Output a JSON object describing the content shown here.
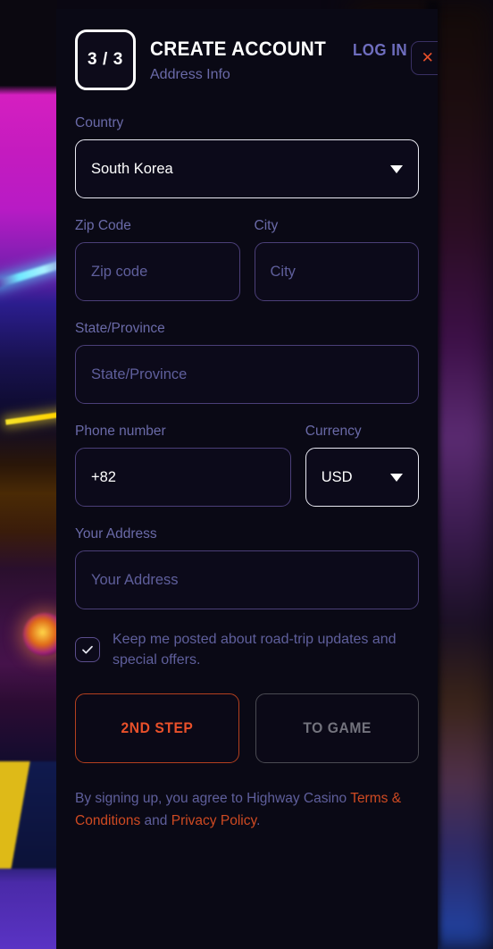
{
  "header": {
    "step_badge": "3 / 3",
    "title": "CREATE ACCOUNT",
    "login_label": "LOG IN",
    "subtitle": "Address Info",
    "close_icon": "close-icon",
    "close_glyph": "✕"
  },
  "form": {
    "country": {
      "label": "Country",
      "value": "South Korea",
      "caret_icon": "chevron-down-icon"
    },
    "zip": {
      "label": "Zip Code",
      "placeholder": "Zip code",
      "value": ""
    },
    "city": {
      "label": "City",
      "placeholder": "City",
      "value": ""
    },
    "state": {
      "label": "State/Province",
      "placeholder": "State/Province",
      "value": ""
    },
    "phone": {
      "label": "Phone number",
      "value": "+82"
    },
    "currency": {
      "label": "Currency",
      "value": "USD",
      "caret_icon": "chevron-down-icon"
    },
    "address": {
      "label": "Your Address",
      "placeholder": "Your Address",
      "value": ""
    }
  },
  "consent": {
    "checked": true,
    "check_icon": "check-icon",
    "text": "Keep me posted about road-trip updates and special offers."
  },
  "actions": {
    "primary_label": "2ND STEP",
    "secondary_label": "TO GAME"
  },
  "footer": {
    "prefix": "By signing up, you agree to Highway Casino ",
    "terms_label": "Terms & Conditions",
    "middle": " and ",
    "privacy_label": "Privacy Policy",
    "suffix": "."
  },
  "colors": {
    "panel_bg": "#0a0915",
    "accent_orange": "#e8502a",
    "label_purple": "#6a6aa8",
    "border_purple": "#4b3f78",
    "active_border": "#e9e9f2",
    "white": "#ffffff"
  }
}
